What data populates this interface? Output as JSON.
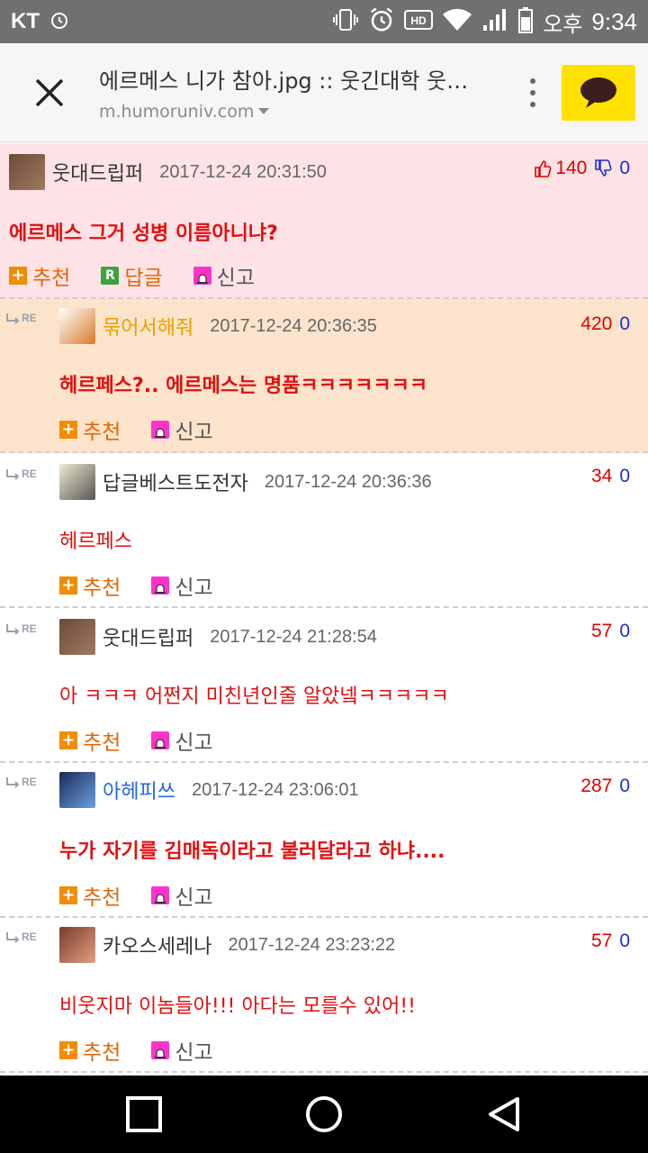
{
  "status_bar": {
    "carrier": "KT",
    "time_period": "오후",
    "time": "9:34",
    "hd_label": "HD"
  },
  "browser": {
    "page_title": "에르메스 니가 참아.jpg :: 웃긴대학 웃…",
    "domain": "m.humoruniv.com"
  },
  "comments": [
    {
      "nick": "웃대드립퍼",
      "nick_color": "#333333",
      "date": "2017-12-24 20:31:50",
      "up": "140",
      "down": "0",
      "text": "에르메스 그거 성병 이름아니냐?",
      "bold": true,
      "bg": "#fde3e6",
      "is_reply": false,
      "actions": {
        "recommend": "추천",
        "reply": "답글",
        "report": "신고"
      }
    },
    {
      "nick": "묶어서해줘",
      "nick_color": "#e8a000",
      "date": "2017-12-24 20:36:35",
      "up": "420",
      "down": "0",
      "text": "헤르페스?.. 에르메스는 명품ㅋㅋㅋㅋㅋㅋㅋ",
      "bold": true,
      "bg": "#fce4cc",
      "is_reply": true,
      "actions": {
        "recommend": "추천",
        "report": "신고"
      }
    },
    {
      "nick": "답글베스트도전자",
      "nick_color": "#333333",
      "date": "2017-12-24 20:36:36",
      "up": "34",
      "down": "0",
      "text": "헤르페스",
      "bold": false,
      "bg": "#ffffff",
      "is_reply": true,
      "actions": {
        "recommend": "추천",
        "report": "신고"
      }
    },
    {
      "nick": "웃대드립퍼",
      "nick_color": "#333333",
      "date": "2017-12-24 21:28:54",
      "up": "57",
      "down": "0",
      "text": "아 ㅋㅋㅋ 어쩐지 미친년인줄 알았넼ㅋㅋㅋㅋㅋ",
      "bold": false,
      "bg": "#ffffff",
      "is_reply": true,
      "actions": {
        "recommend": "추천",
        "report": "신고"
      }
    },
    {
      "nick": "아헤피쓰",
      "nick_color": "#2266dd",
      "date": "2017-12-24 23:06:01",
      "up": "287",
      "down": "0",
      "text": "누가 자기를 김매독이라고 불러달라고 하냐....",
      "bold": true,
      "bg": "#ffffff",
      "is_reply": true,
      "actions": {
        "recommend": "추천",
        "report": "신고"
      }
    },
    {
      "nick": "카오스세레나",
      "nick_color": "#333333",
      "date": "2017-12-24 23:23:22",
      "up": "57",
      "down": "0",
      "text": "비웃지마 이놈들아!!! 아다는 모를수 있어!!",
      "bold": false,
      "bg": "#ffffff",
      "is_reply": true,
      "actions": {
        "recommend": "추천",
        "report": "신고"
      }
    }
  ],
  "re_label": "RE",
  "colors": {
    "statusbar": "#707070",
    "kakao_yellow": "#ffe100",
    "vote_up": "#e00000",
    "vote_down": "#1f2fd0",
    "comment_text": "#e01010"
  }
}
